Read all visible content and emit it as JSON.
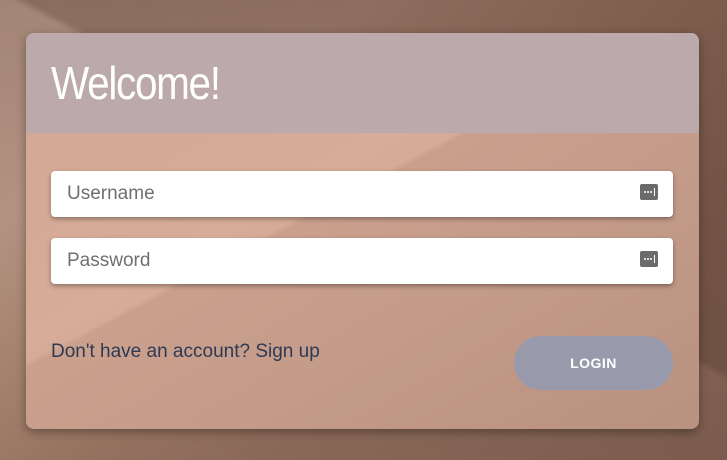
{
  "card": {
    "title": "Welcome!"
  },
  "form": {
    "username": {
      "placeholder": "Username",
      "value": ""
    },
    "password": {
      "placeholder": "Password",
      "value": ""
    },
    "signup_text": "Don't have an account? Sign up",
    "login_label": "LOGIN"
  },
  "icons": {
    "username_field_icon": "password-dots-icon",
    "password_field_icon": "password-dots-icon"
  },
  "colors": {
    "header_bg": "#bba9ab",
    "card_bg": "#d7ac98",
    "login_button": "#989aab",
    "signup_text": "#2e3a55"
  }
}
